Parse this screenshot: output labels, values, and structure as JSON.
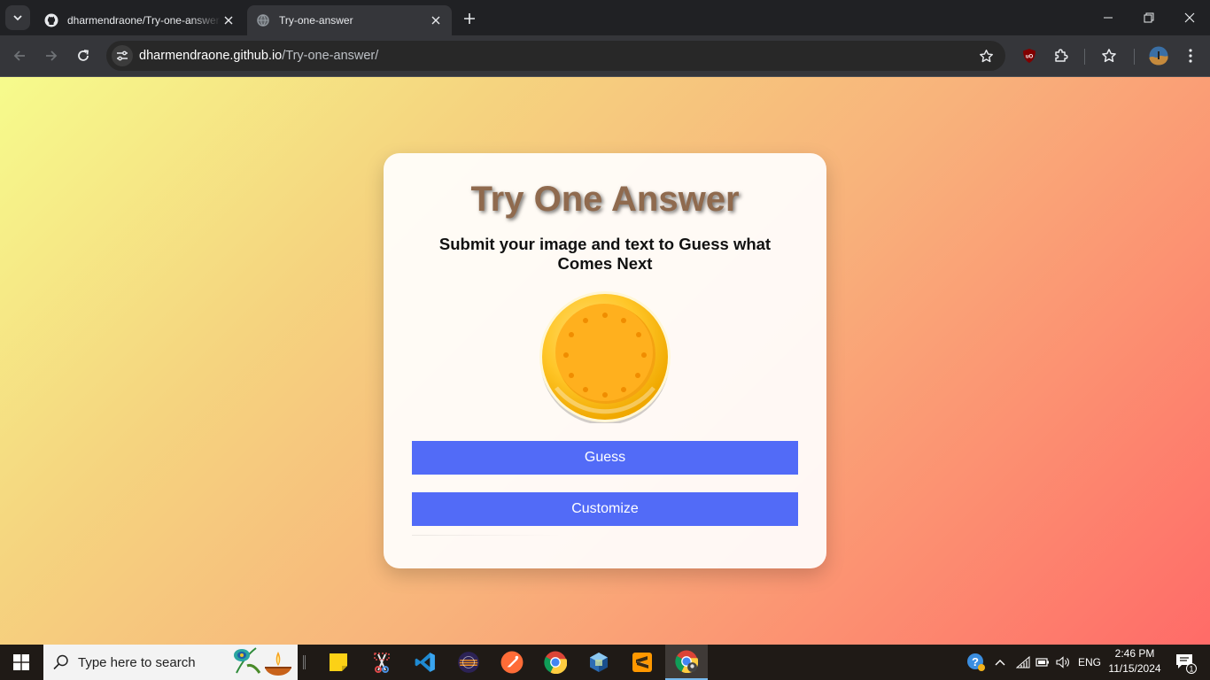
{
  "browser": {
    "tabs": [
      {
        "title": "dharmendraone/Try-one-answer",
        "favicon": "github-icon",
        "active": false
      },
      {
        "title": "Try-one-answer",
        "favicon": "globe-icon",
        "active": true
      }
    ],
    "url_host": "dharmendraone.github.io",
    "url_path": "/Try-one-answer/"
  },
  "page": {
    "title": "Try One Answer",
    "subtitle": "Submit your image and text to Guess what Comes Next",
    "image": "gold-coin-icon",
    "buttons": {
      "guess": "Guess",
      "customize": "Customize"
    }
  },
  "taskbar": {
    "search_placeholder": "Type here to search",
    "apps": [
      "sticky-notes-icon",
      "snipping-tool-icon",
      "vscode-icon",
      "eclipse-icon",
      "postman-icon",
      "chrome-icon",
      "virtualbox-icon",
      "sublime-text-icon",
      "chrome-profile-icon"
    ],
    "language": "ENG",
    "time": "2:46 PM",
    "date": "11/15/2024",
    "notification_count": "1"
  },
  "colors": {
    "button": "#526bf7",
    "title_text": "#8f6a4e",
    "gradient_start": "#f6fb8c",
    "gradient_end": "#ff6b68"
  }
}
